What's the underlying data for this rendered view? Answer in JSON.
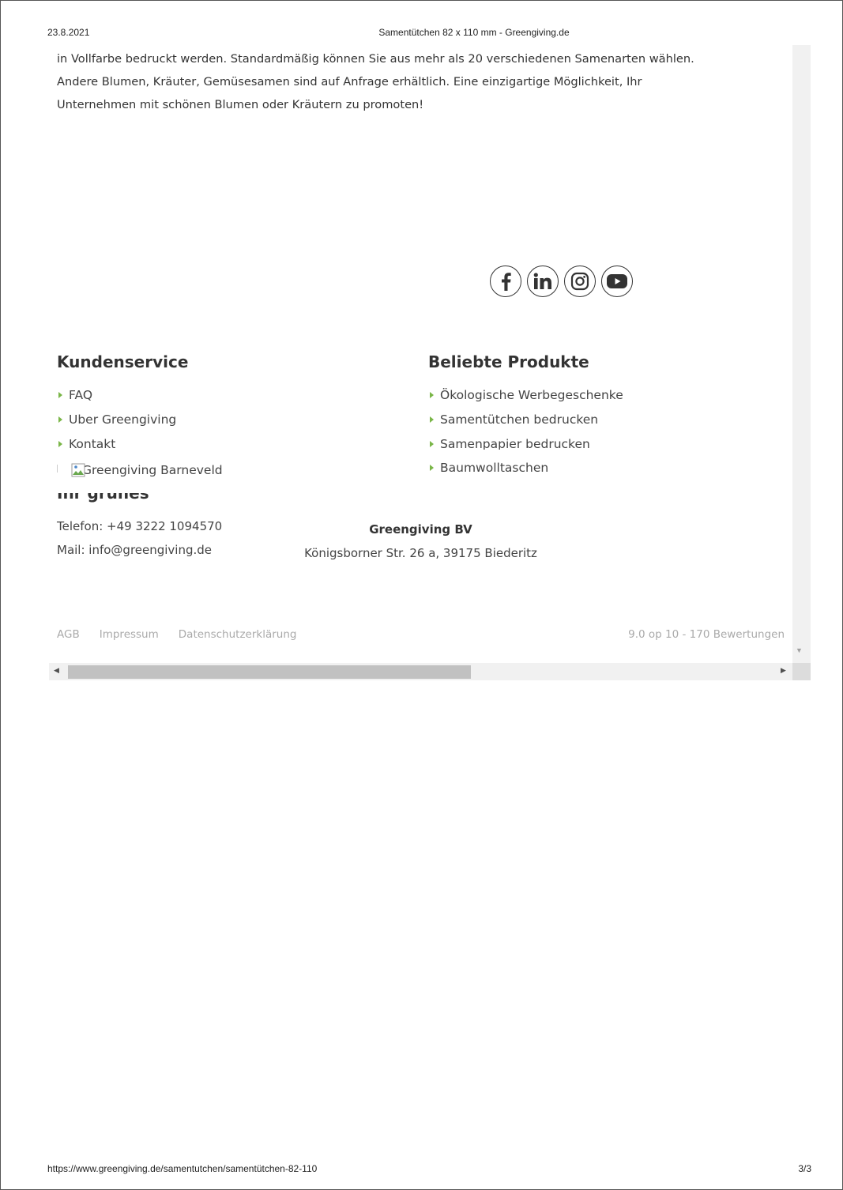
{
  "print_header": {
    "date": "23.8.2021",
    "title": "Samentütchen 82 x 110 mm - Greengiving.de"
  },
  "print_footer": {
    "url": "https://www.greengiving.de/samentutchen/samentütchen-82-110",
    "page": "3/3"
  },
  "intro": {
    "lines": [
      "in Vollfarbe bedruckt werden. Standardmäßig können Sie aus mehr als 20 verschiedenen Samenarten wählen.",
      "Andere Blumen, Kräuter, Gemüsesamen sind auf Anfrage erhältlich. Eine einzigartige Möglichkeit, Ihr",
      "Unternehmen mit schönen Blumen oder Kräutern zu promoten!"
    ]
  },
  "socials": [
    "facebook-icon",
    "linkedin-icon",
    "instagram-icon",
    "youtube-icon"
  ],
  "kundenservice": {
    "title": "Kundenservice",
    "items": [
      "FAQ",
      "Uber Greengiving",
      "Kontakt"
    ]
  },
  "produkte": {
    "title": "Beliebte Produkte",
    "items": [
      "Ökologische Werbegeschenke",
      "Samentütchen bedrucken",
      "Samenpapier bedrucken",
      "Baumwolltaschen"
    ]
  },
  "broken_image_alt": "Greengiving Barneveld",
  "hidden_heading": "Ihr grünes Werbegeschenk",
  "contact": {
    "phone": "Telefon: +49 3222 1094570",
    "mail": "Mail: info@greengiving.de"
  },
  "company": {
    "name": "Greengiving BV",
    "address": "Königsborner Str. 26 a, 39175 Biederitz"
  },
  "footer": {
    "links": [
      "AGB",
      "Impressum",
      "Datenschutzerklärung"
    ],
    "rating": "9.0 op 10 - 170 Bewertungen"
  },
  "colors": {
    "bullet": "#7ab648",
    "text": "#333333",
    "muted": "#aaaaaa"
  }
}
